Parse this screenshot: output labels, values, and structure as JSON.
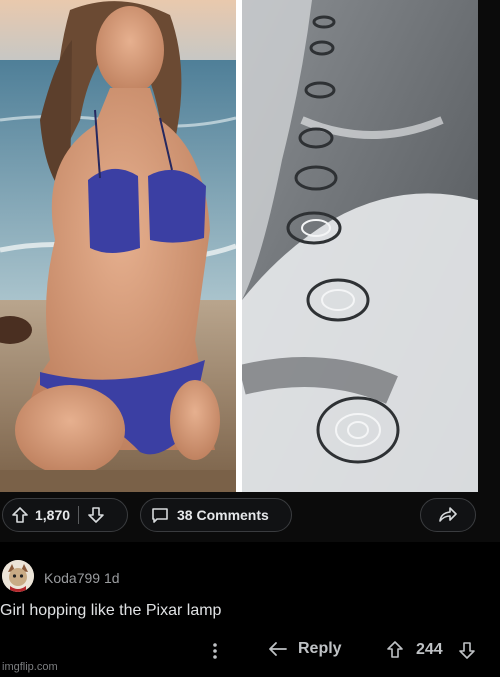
{
  "post": {
    "score": "1,870",
    "comments_label": "38 Comments"
  },
  "comment": {
    "username": "Koda799",
    "age": "1d",
    "text": "Girl hopping like the Pixar lamp",
    "reply_label": "Reply",
    "score": "244"
  },
  "watermark": "imgflip.com",
  "icons": {
    "upvote": "upvote-arrow-icon",
    "downvote": "downvote-arrow-icon",
    "comments": "comment-bubble-icon",
    "share": "share-arrow-icon",
    "more": "vertical-dots-icon",
    "reply": "reply-arrow-icon"
  },
  "colors": {
    "background": "#000000",
    "bar": "#0b0b0b",
    "text": "#d7dadc",
    "muted": "#9a9c9f"
  }
}
